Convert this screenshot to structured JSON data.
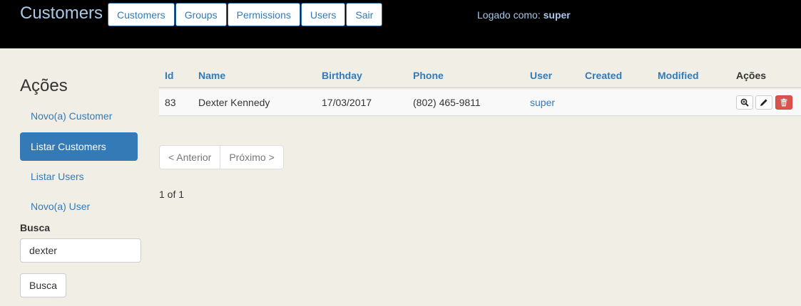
{
  "header": {
    "brand": "Customers",
    "nav": [
      "Customers",
      "Groups",
      "Permissions",
      "Users",
      "Sair"
    ],
    "logged_label": "Logado como:",
    "logged_user": "super"
  },
  "sidebar": {
    "title": "Ações",
    "items": [
      {
        "label": "Novo(a) Customer",
        "active": false
      },
      {
        "label": "Listar Customers",
        "active": true
      },
      {
        "label": "Listar Users",
        "active": false
      },
      {
        "label": "Novo(a) User",
        "active": false
      }
    ],
    "search_label": "Busca",
    "search_value": "dexter",
    "search_button": "Busca"
  },
  "table": {
    "columns": [
      "Id",
      "Name",
      "Birthday",
      "Phone",
      "User",
      "Created",
      "Modified",
      "Ações"
    ],
    "rows": [
      {
        "id": "83",
        "name": "Dexter Kennedy",
        "birthday": "17/03/2017",
        "phone": "(802) 465-9811",
        "user": "super",
        "created": "",
        "modified": ""
      }
    ],
    "row_actions": [
      "view-icon",
      "edit-icon",
      "delete-icon"
    ]
  },
  "pagination": {
    "prev": "< Anterior",
    "next": "Próximo >",
    "counter": "1 of 1"
  },
  "colors": {
    "accent": "#337ab7",
    "topbar": "#000000",
    "background": "#f1eee6",
    "danger": "#d9534f"
  }
}
